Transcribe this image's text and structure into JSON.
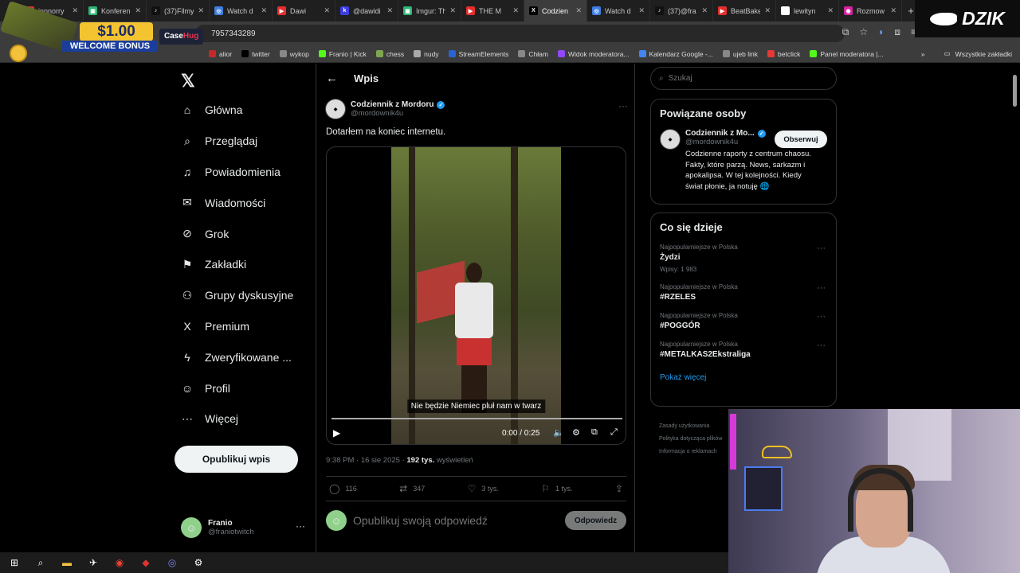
{
  "browser": {
    "tabs": [
      {
        "label": "innnorry",
        "fav": "▶",
        "color": "#e62e2e",
        "active": false
      },
      {
        "label": "Konferen",
        "fav": "▣",
        "color": "#2bb673",
        "active": false
      },
      {
        "label": "(37)Filmy",
        "fav": "♪",
        "color": "#111111",
        "active": false
      },
      {
        "label": "Watch d",
        "fav": "◎",
        "color": "#3f7de0",
        "active": false
      },
      {
        "label": "Dawi",
        "fav": "▶",
        "color": "#e62e2e",
        "active": false
      },
      {
        "label": "@dawidi",
        "fav": "k",
        "color": "#3b3ee0",
        "active": false
      },
      {
        "label": "Imgur: Th",
        "fav": "▣",
        "color": "#2bb673",
        "active": false
      },
      {
        "label": "THE M",
        "fav": "▶",
        "color": "#e62e2e",
        "active": false
      },
      {
        "label": "Codzien",
        "fav": "X",
        "color": "#000000",
        "active": true
      },
      {
        "label": "Watch d",
        "fav": "◎",
        "color": "#3f7de0",
        "active": false
      },
      {
        "label": "(37)@fra",
        "fav": "♪",
        "color": "#111111",
        "active": false
      },
      {
        "label": "BeatBake",
        "fav": "▶",
        "color": "#e62e2e",
        "active": false
      },
      {
        "label": "lewityn",
        "fav": "G",
        "color": "#ffffff",
        "active": false
      },
      {
        "label": "Rozmow",
        "fav": "◉",
        "color": "#d6249f",
        "active": false
      }
    ],
    "url": "7957343289",
    "bookmarks": [
      {
        "label": "alior",
        "color": "#c62828"
      },
      {
        "label": "twitter",
        "color": "#000000"
      },
      {
        "label": "wykop",
        "color": "#888888"
      },
      {
        "label": "Franio | Kick",
        "color": "#53fc18"
      },
      {
        "label": "chess",
        "color": "#7fa650"
      },
      {
        "label": "nudy",
        "color": "#aaaaaa"
      },
      {
        "label": "StreamElements",
        "color": "#2a63d4"
      },
      {
        "label": "Chłam",
        "color": "#888888"
      },
      {
        "label": "Widok moderatora...",
        "color": "#9146ff"
      },
      {
        "label": "Kalendarz Google -...",
        "color": "#4285f4"
      },
      {
        "label": "ujeb link",
        "color": "#888888"
      },
      {
        "label": "betclick",
        "color": "#e53935"
      },
      {
        "label": "Panel moderatora |...",
        "color": "#53fc18"
      }
    ],
    "bookmarks_more": "»",
    "all_bookmarks": "Wszystkie zakładki"
  },
  "ad": {
    "price": "$1.00",
    "bonus": "WELCOME BONUS",
    "brand_case": "Case",
    "brand_hug": "Hug"
  },
  "overlay_logo": "DZIK",
  "sidebar": {
    "items": [
      {
        "label": "Główna",
        "icon": "⌂",
        "name": "home"
      },
      {
        "label": "Przeglądaj",
        "icon": "⌕",
        "name": "explore"
      },
      {
        "label": "Powiadomienia",
        "icon": "♫",
        "name": "notifications"
      },
      {
        "label": "Wiadomości",
        "icon": "✉",
        "name": "messages"
      },
      {
        "label": "Grok",
        "icon": "⊘",
        "name": "grok"
      },
      {
        "label": "Zakładki",
        "icon": "⚑",
        "name": "bookmarks"
      },
      {
        "label": "Grupy dyskusyjne",
        "icon": "⚇",
        "name": "communities"
      },
      {
        "label": "Premium",
        "icon": "X",
        "name": "premium"
      },
      {
        "label": "Zweryfikowane ...",
        "icon": "ϟ",
        "name": "verified-orgs"
      },
      {
        "label": "Profil",
        "icon": "☺",
        "name": "profile"
      },
      {
        "label": "Więcej",
        "icon": "⋯",
        "name": "more"
      }
    ],
    "post_button": "Opublikuj wpis",
    "account": {
      "name": "Franio",
      "handle": "@franiotwitch"
    }
  },
  "main": {
    "header": "Wpis",
    "post": {
      "author_name": "Codziennik z Mordoru",
      "author_handle": "@mordownik4u",
      "text": "Dotarłem na koniec internetu.",
      "video": {
        "subtitle": "Nie będzie Niemiec pluł nam w twarz",
        "time": "0:00 / 0:25",
        "progress": 0
      },
      "timestamp": "9:38 PM · 16 sie 2025 · ",
      "views_count": "192 tys.",
      "views_label": " wyświetleń",
      "stats": {
        "replies": "116",
        "reposts": "347",
        "likes": "3 tys.",
        "bookmarks": "1 tys."
      }
    },
    "reply_placeholder": "Opublikuj swoją odpowiedź",
    "reply_button": "Odpowiedz"
  },
  "right": {
    "search_placeholder": "Szukaj",
    "related": {
      "title": "Powiązane osoby",
      "name": "Codziennik z Mo...",
      "handle": "@mordownik4u",
      "follow": "Obserwuj",
      "bio": "Codzienne raporty z centrum chaosu. Fakty, które parzą. News, sarkazm i apokalipsa. W tej kolejności. Kiedy świat płonie, ja notuję 🌐"
    },
    "trends": {
      "title": "Co się dzieje",
      "items": [
        {
          "meta": "Najpopularniejsze w Polska",
          "name": "Żydzi",
          "count": "Wpisy: 1 983"
        },
        {
          "meta": "Najpopularniejsze w Polska",
          "name": "#RZELES",
          "count": ""
        },
        {
          "meta": "Najpopularniejsze w Polska",
          "name": "#POGGÓR",
          "count": ""
        },
        {
          "meta": "Najpopularniejsze w Polska",
          "name": "#METALKAS2Ekstraliga",
          "count": ""
        }
      ],
      "show_more": "Pokaż więcej"
    },
    "footer": [
      "Zasady użytkowania",
      "Polityka dotycząca plików",
      "Informacja o reklamach"
    ]
  }
}
